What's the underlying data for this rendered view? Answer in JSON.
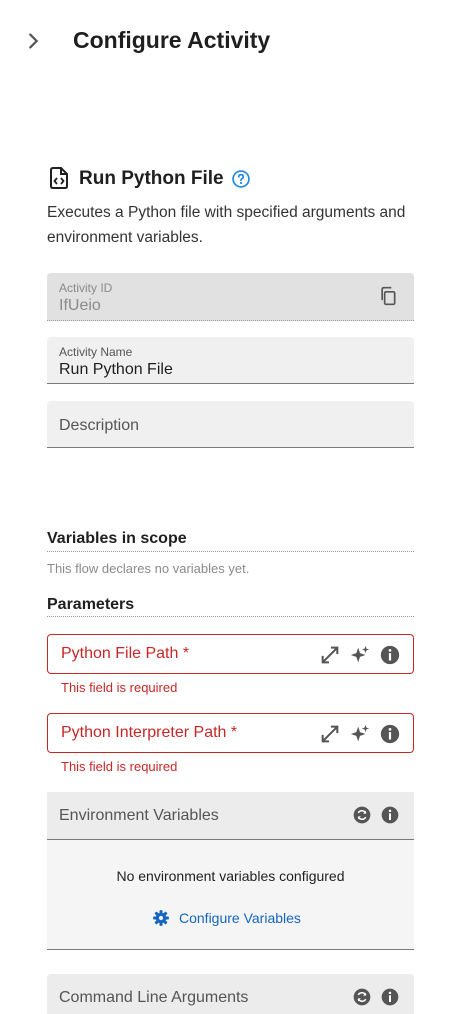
{
  "header": {
    "title": "Configure Activity",
    "expand_icon": "chevron-right-icon"
  },
  "activity": {
    "icon": "code-file-icon",
    "title": "Run Python File",
    "help_icon": "help-circle-icon",
    "description": "Executes a Python file with specified arguments and environment variables."
  },
  "fields": {
    "activity_id": {
      "label": "Activity ID",
      "value": "IfUeio",
      "copy_icon": "copy-icon"
    },
    "activity_name": {
      "label": "Activity Name",
      "value": "Run Python File"
    },
    "description": {
      "placeholder": "Description"
    }
  },
  "variables": {
    "title": "Variables in scope",
    "note": "This flow declares no variables yet."
  },
  "parameters": {
    "title": "Parameters",
    "python_file_path": {
      "placeholder": "Python File Path *",
      "error": "This field is required"
    },
    "python_interpreter_path": {
      "placeholder": "Python Interpreter Path *",
      "error": "This field is required"
    }
  },
  "environment": {
    "title": "Environment Variables",
    "empty": "No environment variables configured",
    "button": "Configure Variables"
  },
  "command_line": {
    "title": "Command Line Arguments"
  },
  "colors": {
    "error": "#c62828",
    "link": "#1565c0",
    "field_bg": "#f0f0f0"
  }
}
